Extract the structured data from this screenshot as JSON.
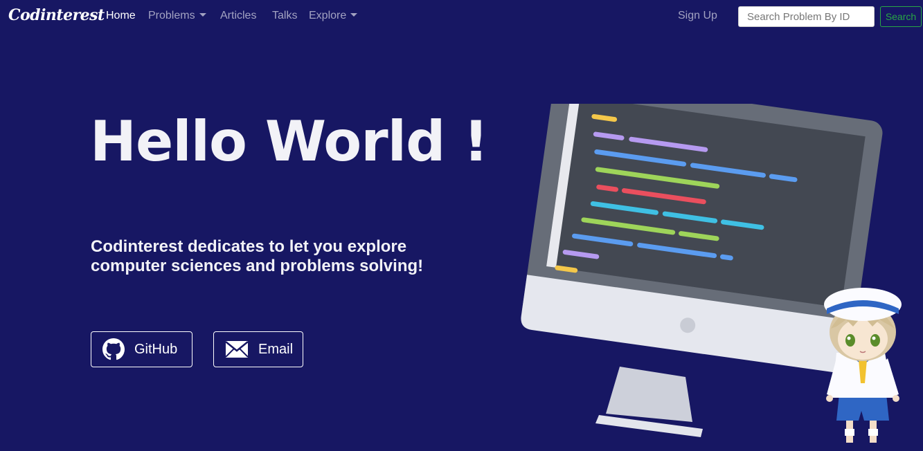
{
  "brand": {
    "name": "Codinterest"
  },
  "nav": {
    "items": [
      {
        "label": "Home",
        "active": true
      },
      {
        "label": "Problems",
        "dropdown": true
      },
      {
        "label": "Articles"
      },
      {
        "label": "Talks"
      },
      {
        "label": "Explore",
        "dropdown": true
      }
    ],
    "signup": "Sign Up",
    "search_placeholder": "Search Problem By ID",
    "search_value": "",
    "search_button": "Search"
  },
  "hero": {
    "title": "Hello World !",
    "subtitle": "Codinterest dedicates to let you explore computer sciences and problems solving!",
    "buttons": [
      {
        "label": "GitHub",
        "icon": "github-icon"
      },
      {
        "label": "Email",
        "icon": "envelope-icon"
      }
    ]
  },
  "colors": {
    "background": "#171763",
    "nav_text": "#a3a3c2",
    "accent_green": "#28a745"
  }
}
